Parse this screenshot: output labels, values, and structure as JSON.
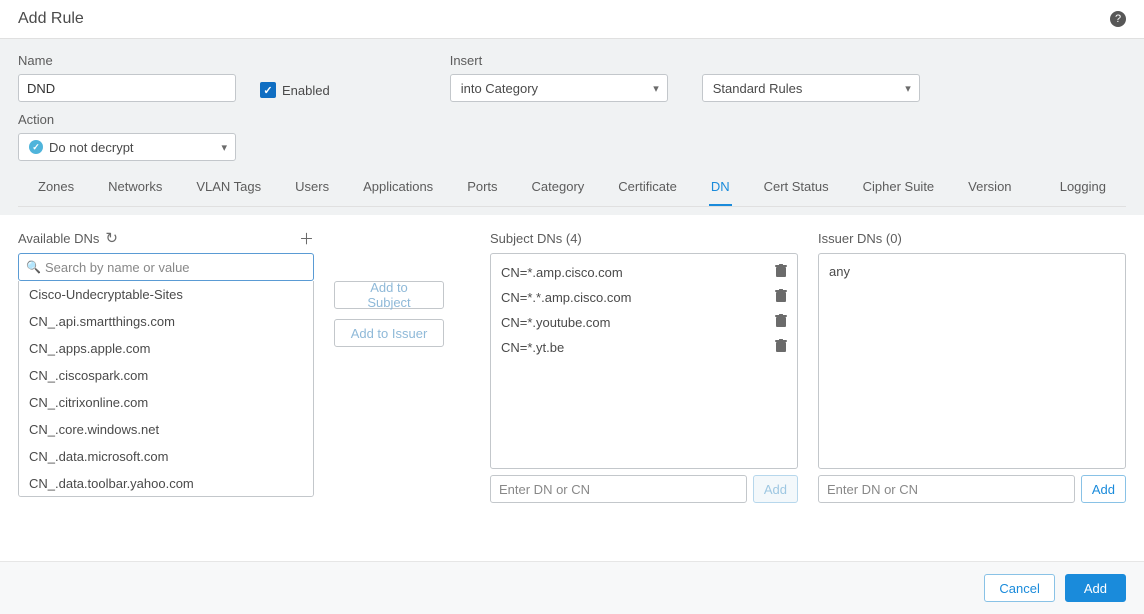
{
  "dialog": {
    "title": "Add Rule"
  },
  "fields": {
    "name_label": "Name",
    "name_value": "DND",
    "enabled_label": "Enabled",
    "enabled_checked": true,
    "insert_label": "Insert",
    "insert_value": "into Category",
    "rules_value": "Standard Rules",
    "action_label": "Action",
    "action_value": "Do not decrypt"
  },
  "tabs": {
    "items": [
      "Zones",
      "Networks",
      "VLAN Tags",
      "Users",
      "Applications",
      "Ports",
      "Category",
      "Certificate",
      "DN",
      "Cert Status",
      "Cipher Suite",
      "Version"
    ],
    "active_index": 8,
    "logging_label": "Logging"
  },
  "available": {
    "title": "Available DNs",
    "search_placeholder": "Search by name or value",
    "items": [
      "Cisco-Undecryptable-Sites",
      "CN_.api.smartthings.com",
      "CN_.apps.apple.com",
      "CN_.ciscospark.com",
      "CN_.citrixonline.com",
      "CN_.core.windows.net",
      "CN_.data.microsoft.com",
      "CN_.data.toolbar.yahoo.com"
    ]
  },
  "transfer": {
    "add_subject": "Add to Subject",
    "add_issuer": "Add to Issuer"
  },
  "subject": {
    "title": "Subject DNs (4)",
    "items": [
      "CN=*.amp.cisco.com",
      "CN=*.*.amp.cisco.com",
      "CN=*.youtube.com",
      "CN=*.yt.be"
    ],
    "input_placeholder": "Enter DN or CN",
    "add_label": "Add"
  },
  "issuer": {
    "title": "Issuer DNs (0)",
    "placeholder_text": "any",
    "input_placeholder": "Enter DN or CN",
    "add_label": "Add"
  },
  "footer": {
    "cancel": "Cancel",
    "add": "Add"
  }
}
